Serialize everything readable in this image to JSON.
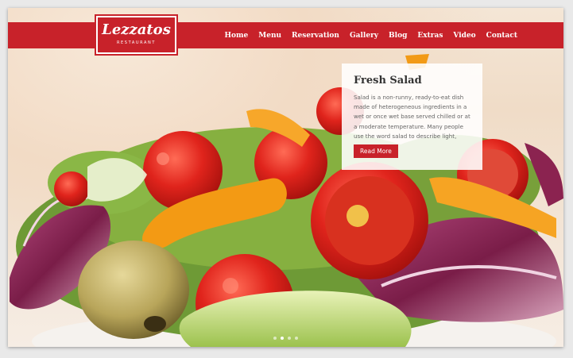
{
  "brand": {
    "name": "Lezzatos",
    "tagline": "RESTAURANT"
  },
  "nav": [
    "Home",
    "Menu",
    "Reservation",
    "Gallery",
    "Blog",
    "Extras",
    "Video",
    "Contact"
  ],
  "slide": {
    "title": "Fresh Salad",
    "text": "Salad is a non-runny, ready-to-eat dish made of heterogeneous ingredients in a wet or once wet base served chilled or at a moderate temperature. Many people use the word salad to describe light, savory",
    "button_label": "Read More"
  },
  "slider": {
    "count": 4,
    "active_index": 1
  },
  "colors": {
    "brand_red": "#c8222a",
    "card_bg": "#ffffff"
  },
  "image": {
    "subject": "salad-bowl-photo"
  }
}
